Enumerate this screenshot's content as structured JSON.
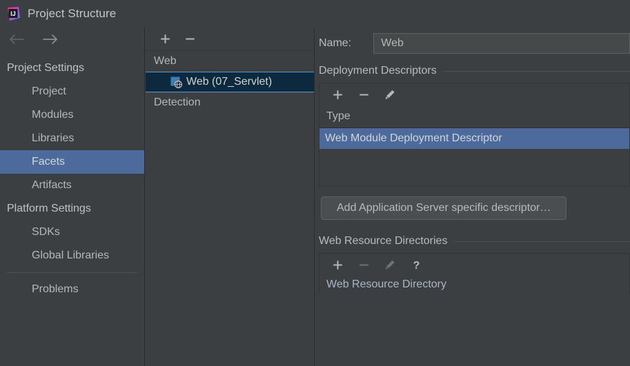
{
  "window": {
    "title": "Project Structure",
    "app_icon": "intellij-idea-logo"
  },
  "nav": {
    "back_icon": "arrow-left-icon",
    "forward_icon": "arrow-right-icon"
  },
  "sidebar": {
    "groups": [
      {
        "label": "Project Settings",
        "type": "group"
      },
      {
        "label": "Project",
        "type": "child"
      },
      {
        "label": "Modules",
        "type": "child"
      },
      {
        "label": "Libraries",
        "type": "child"
      },
      {
        "label": "Facets",
        "type": "child",
        "selected": true
      },
      {
        "label": "Artifacts",
        "type": "child"
      },
      {
        "label": "Platform Settings",
        "type": "group"
      },
      {
        "label": "SDKs",
        "type": "child"
      },
      {
        "label": "Global Libraries",
        "type": "child"
      },
      {
        "label": "Problems",
        "type": "child"
      }
    ],
    "selection_color": "#4c6a9b"
  },
  "facet_panel": {
    "toolbar": {
      "add_icon": "plus-icon",
      "remove_icon": "minus-icon"
    },
    "items": [
      {
        "label": "Web",
        "icon": null,
        "indent": false,
        "selected": false
      },
      {
        "label": "Web (07_Servlet)",
        "icon": "web-facet-icon",
        "indent": true,
        "selected": true
      },
      {
        "label": "Detection",
        "icon": null,
        "indent": false,
        "selected": false
      }
    ],
    "selection_bg": "#0d293e",
    "selection_border": "#5a9ad0"
  },
  "details": {
    "name_label": "Name:",
    "name_value": "Web",
    "name_placeholder": "Name",
    "deployment_descriptors": {
      "section_title": "Deployment Descriptors",
      "toolbar": {
        "add_icon": "plus-icon",
        "remove_icon": "minus-icon",
        "edit_icon": "pencil-icon"
      },
      "columns": [
        "Type"
      ],
      "rows": [
        {
          "type": "Web Module Deployment Descriptor",
          "selected": true
        }
      ],
      "selection_color": "#4c6a9b"
    },
    "add_descriptor_button": "Add Application Server specific descriptor…",
    "web_resource_directories": {
      "section_title": "Web Resource Directories",
      "toolbar": {
        "add_icon": "plus-icon",
        "remove_icon": "minus-icon",
        "edit_icon": "pencil-icon",
        "help_icon": "question-mark-icon"
      },
      "columns": [
        "Web Resource Directory"
      ]
    }
  }
}
